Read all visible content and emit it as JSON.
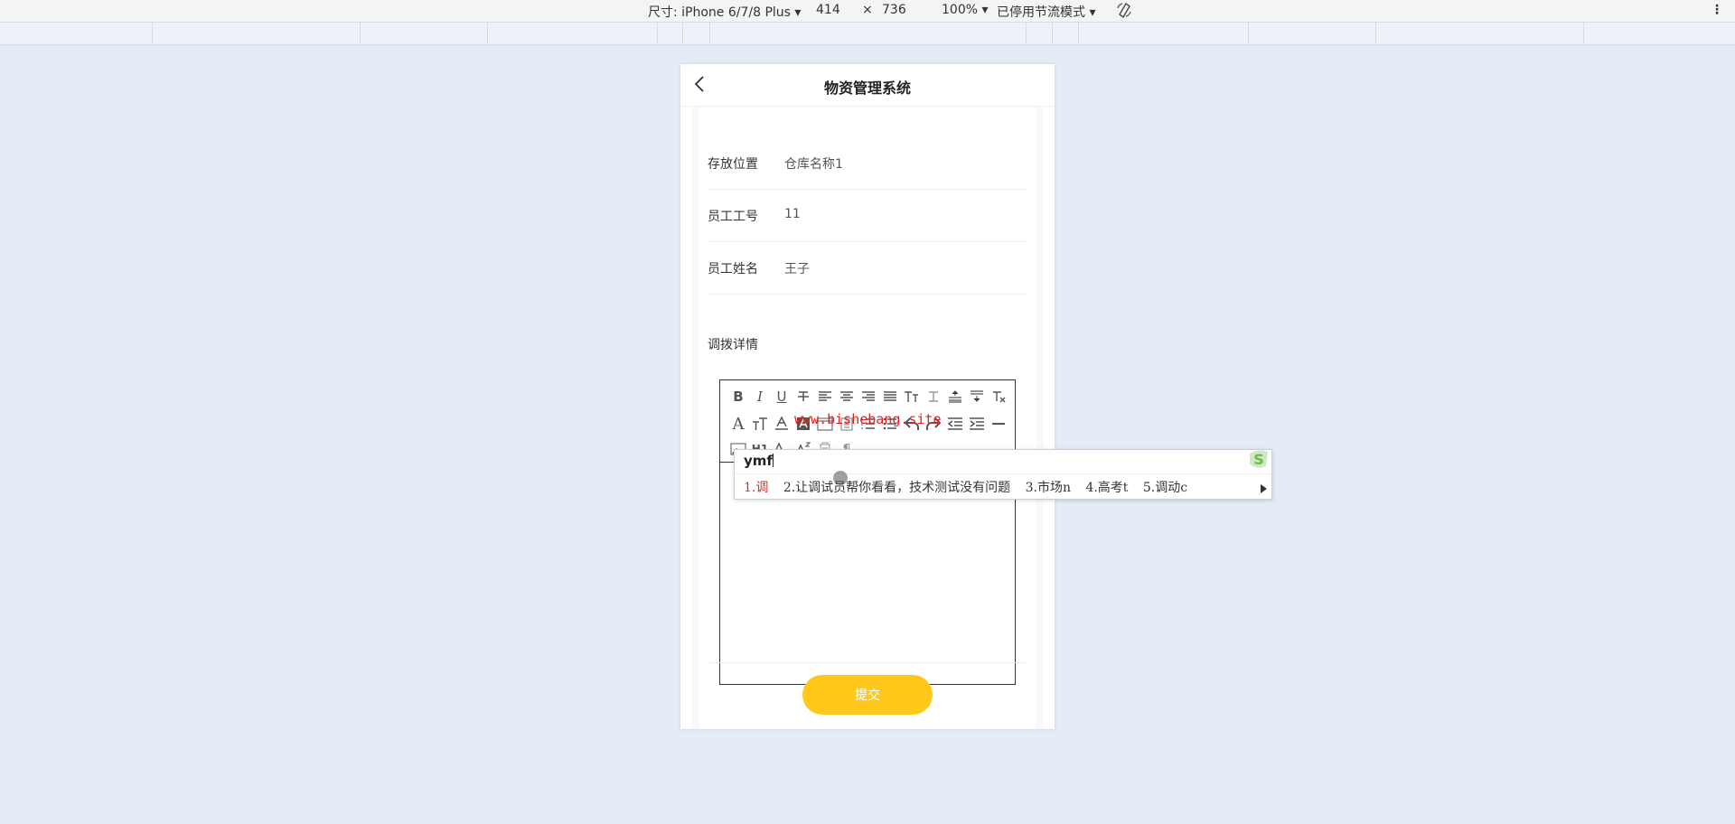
{
  "devtools": {
    "device_label": "尺寸: iPhone 6/7/8 Plus",
    "width": "414",
    "times": "×",
    "height": "736",
    "zoom": "100%",
    "throttle": "已停用节流模式"
  },
  "app": {
    "title": "物资管理系统"
  },
  "form": {
    "fields": [
      {
        "label": "存放位置",
        "value": "仓库名称1"
      },
      {
        "label": "员工工号",
        "value": "11"
      },
      {
        "label": "员工姓名",
        "value": "王子"
      }
    ],
    "detail_label": "调拨详情",
    "editor_text": "ymf",
    "toolbar_text_tools": [
      "B",
      "I",
      "U",
      "H1"
    ],
    "submit_label": "提交"
  },
  "watermark": "www.bishebang.site",
  "ime": {
    "input": "ymf",
    "candidates": [
      "1.调",
      "2.让调试员帮你看看，技术测试没有问题",
      "3.市场n",
      "4.高考t",
      "5.调动c"
    ]
  },
  "colors": {
    "submit": "#ffc81a",
    "background": "#e3ebf6",
    "watermark": "#e02020"
  }
}
